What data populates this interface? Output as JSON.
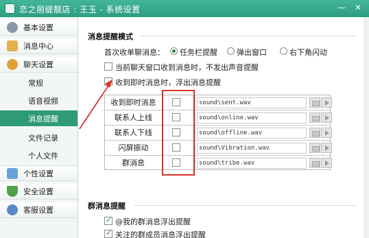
{
  "window": {
    "title": "恋之丽缇靓店 : 王玉 - 系统设置",
    "controls": [
      "—",
      "✕"
    ]
  },
  "sidebar": {
    "items": [
      {
        "label": "基本设置",
        "icon": "gear-icon",
        "color": "#8a97a6",
        "kind": "top"
      },
      {
        "label": "消息中心",
        "icon": "envelope-icon",
        "color": "#e3b14a",
        "kind": "top"
      },
      {
        "label": "聊天设置",
        "icon": "chat-bubble-icon",
        "color": "#e0a03a",
        "kind": "top"
      },
      {
        "label": "常规",
        "kind": "sub"
      },
      {
        "label": "语音视频",
        "kind": "sub"
      },
      {
        "label": "消息提醒",
        "kind": "sub",
        "active": true
      },
      {
        "label": "文件记录",
        "kind": "sub"
      },
      {
        "label": "个人文件",
        "kind": "sub"
      },
      {
        "label": "个性设置",
        "icon": "palette-icon",
        "color": "#6aa2d8",
        "kind": "top"
      },
      {
        "label": "安全设置",
        "icon": "shield-icon",
        "color": "#4fa04a",
        "kind": "top"
      },
      {
        "label": "客服设置",
        "icon": "headset-icon",
        "color": "#5a87c6",
        "kind": "top"
      }
    ]
  },
  "message_reminder": {
    "section_title": "消息提醒模式",
    "first_msg_label": "首次收单聊消息：",
    "radio_options": [
      {
        "label": "任务栏提醒",
        "selected": true
      },
      {
        "label": "弹出窗口",
        "selected": false
      },
      {
        "label": "右下角闪动",
        "selected": false
      }
    ],
    "no_sound_label": "当前聊天窗口收到消息时，不发出声音提醒",
    "float_label": "收到即时消息时，浮出消息提醒"
  },
  "sound_table": {
    "rows": [
      {
        "name": "收到即时消息",
        "path": "sound\\sent.wav"
      },
      {
        "name": "联系人上线",
        "path": "sound\\online.wav"
      },
      {
        "name": "联系人下线",
        "path": "sound\\offline.wav"
      },
      {
        "name": "闪屏振动",
        "path": "sound\\Vibration.wav"
      },
      {
        "name": "群消息",
        "path": "sound\\tribe.wav"
      }
    ]
  },
  "group_reminder": {
    "section_title": "群消息提醒",
    "options": [
      {
        "label": "@我的群消息浮出提醒",
        "checked": true
      },
      {
        "label": "关注的群成员消息浮出提醒",
        "checked": true
      }
    ]
  },
  "colors": {
    "titlebar": "#35a88c",
    "active": "#2f9a77",
    "annotation": "#d8322a"
  }
}
